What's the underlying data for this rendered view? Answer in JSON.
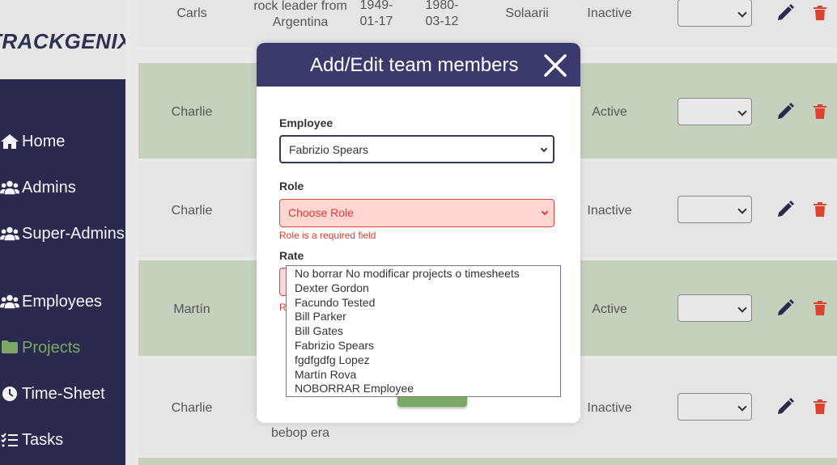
{
  "brand": "TRACKGENIX",
  "nav": [
    {
      "label": "Home",
      "icon": "home-icon"
    },
    {
      "label": "Admins",
      "icon": "users-icon"
    },
    {
      "label": "Super-Admins",
      "icon": "users-icon"
    },
    {
      "label": "Employees",
      "icon": "users-icon"
    },
    {
      "label": "Projects",
      "icon": "folder-icon",
      "active": true
    },
    {
      "label": "Time-Sheet",
      "icon": "clock-icon"
    },
    {
      "label": "Tasks",
      "icon": "tasks-icon"
    }
  ],
  "table": {
    "rows": [
      {
        "name": "Carls",
        "desc": "rock leader from Argentina",
        "start": "1949-01-17",
        "end": "1980-03-12",
        "client": "Solaarii",
        "status": "Inactive"
      },
      {
        "name": "Charlie",
        "status": "Active"
      },
      {
        "name": "Charlie",
        "status": "Inactive"
      },
      {
        "name": "Martín",
        "status": "Active"
      },
      {
        "name": "Charlie",
        "desc_tail": "bebop era",
        "status": "Inactive"
      }
    ]
  },
  "modal": {
    "title": "Add/Edit team members",
    "employee_label": "Employee",
    "employee_value": "Fabrizio Spears",
    "role_label": "Role",
    "role_value": "Choose Role",
    "role_error": "Role is a required field",
    "rate_label": "Rate",
    "rate_error_fragment": "R"
  },
  "dropdown": {
    "options": [
      "No borrar No modificar projects o timesheets",
      "Dexter Gordon",
      "Facundo Tested",
      "Bill Parker",
      "Bill Gates",
      "Fabrizio Spears",
      "fgdfgdfg Lopez",
      "Martín Rova",
      "NOBORRAR Employee"
    ]
  },
  "colors": {
    "sidebar": "#2a2a4e",
    "modal_header": "#3a3a6c",
    "accent_green": "#7ba865",
    "error_red": "#e03a2d",
    "delete_red": "#d9432f"
  }
}
